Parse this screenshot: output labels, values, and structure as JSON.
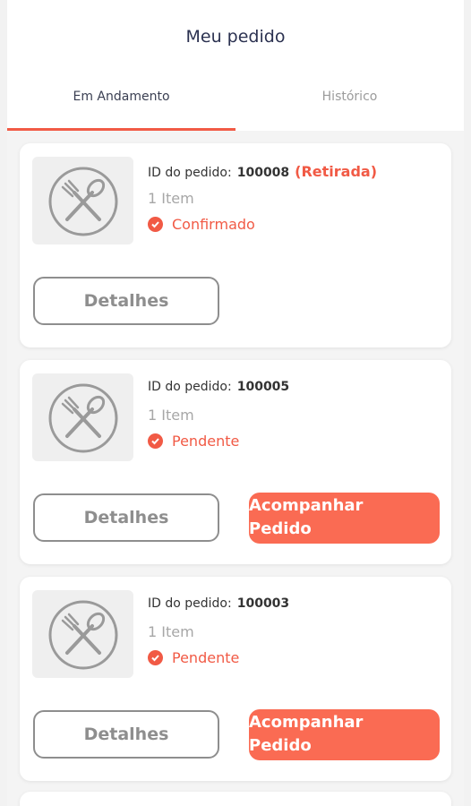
{
  "header": {
    "title": "Meu pedido"
  },
  "tabs": [
    {
      "label": "Em Andamento"
    },
    {
      "label": "Histórico"
    }
  ],
  "orders": [
    {
      "id_label": "ID do pedido:",
      "id": "100008",
      "tag": "(Retirada)",
      "items": "1 Item",
      "status": "Confirmado",
      "details_label": "Detalhes"
    },
    {
      "id_label": "ID do pedido:",
      "id": "100005",
      "items": "1 Item",
      "status": "Pendente",
      "details_label": "Detalhes",
      "track_label_1": "Acompanhar",
      "track_label_2": "Pedido"
    },
    {
      "id_label": "ID do pedido:",
      "id": "100003",
      "items": "1 Item",
      "status": "Pendente",
      "details_label": "Detalhes",
      "track_label_1": "Acompanhar",
      "track_label_2": "Pedido"
    }
  ],
  "colors": {
    "accent": "#f15a45",
    "button": "#fa6b53"
  },
  "icons": {
    "thumbnail": "fork-spoon-icon",
    "status": "check-circle-icon"
  }
}
